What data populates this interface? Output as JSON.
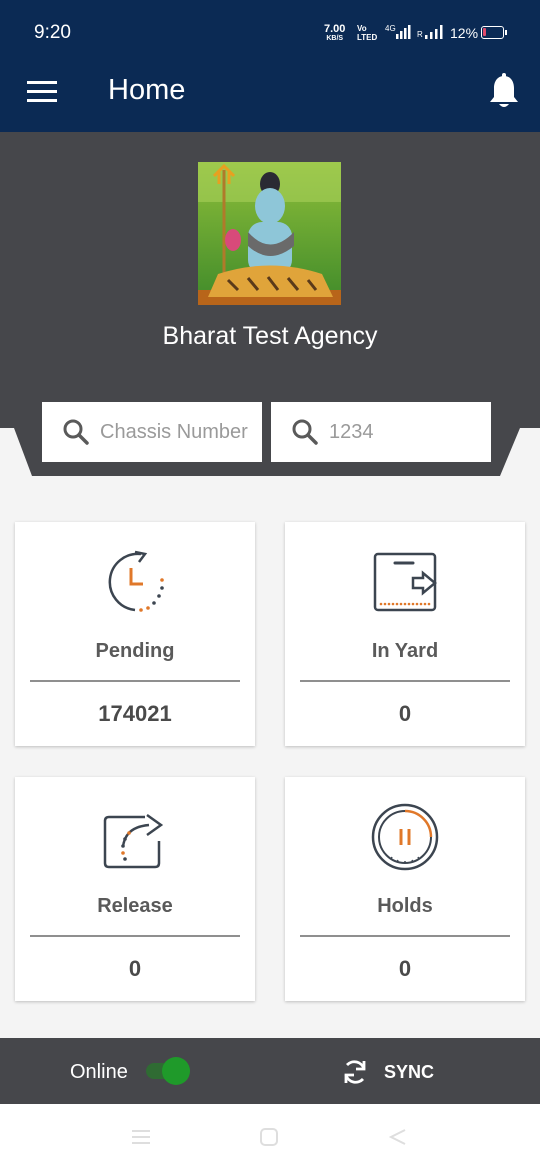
{
  "status_bar": {
    "time": "9:20",
    "net_speed": "7.00",
    "net_unit": "KB/S",
    "volte_top": "Vo",
    "volte_bottom": "LTED",
    "network_type": "4G",
    "roaming": "R",
    "battery": "12%"
  },
  "app_bar": {
    "title": "Home",
    "menu_icon": "hamburger-menu-icon",
    "notification_icon": "bell-icon"
  },
  "profile": {
    "agency_name": "Bharat Test Agency",
    "avatar": "profile-photo"
  },
  "search": {
    "chassis_placeholder": "Chassis Number",
    "second_placeholder": "1234"
  },
  "cards": [
    {
      "label": "Pending",
      "value": "174021",
      "icon": "pending-clock-icon"
    },
    {
      "label": "In Yard",
      "value": "0",
      "icon": "in-yard-icon"
    },
    {
      "label": "Release",
      "value": "0",
      "icon": "release-share-icon"
    },
    {
      "label": "Holds",
      "value": "0",
      "icon": "holds-pause-icon"
    }
  ],
  "bottom_bar": {
    "online_label": "Online",
    "online_toggle": "on",
    "sync_label": "SYNC"
  },
  "nav_bar": {
    "icons": [
      "recents-icon",
      "home-icon",
      "back-icon"
    ]
  },
  "colors": {
    "app_bar": "#0b2a54",
    "hero": "#46474b",
    "accent_orange": "#e0782a",
    "icon_dark": "#3c4550",
    "toggle_on": "#1f9a2a"
  }
}
